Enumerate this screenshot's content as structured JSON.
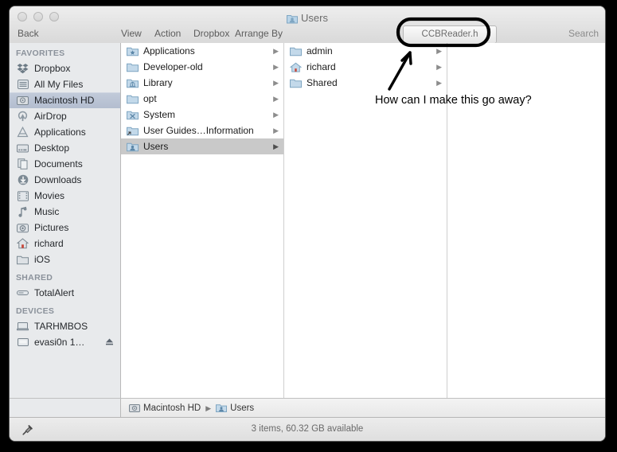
{
  "window": {
    "title": "Users",
    "title_icon": "users-folder-icon"
  },
  "toolbar": {
    "back_label": "Back",
    "view_label": "View",
    "action_label": "Action",
    "dropbox_label": "Dropbox",
    "arrange_by_label": "Arrange By",
    "proxy_item_label": "CCBReader.h",
    "search_label": "Search"
  },
  "sidebar": {
    "sections": [
      {
        "header": "FAVORITES",
        "items": [
          {
            "label": "Dropbox",
            "icon": "dropbox-icon",
            "selected": false
          },
          {
            "label": "All My Files",
            "icon": "all-my-files-icon",
            "selected": false
          },
          {
            "label": "Macintosh HD",
            "icon": "hard-disk-icon",
            "selected": true
          },
          {
            "label": "AirDrop",
            "icon": "airdrop-icon",
            "selected": false
          },
          {
            "label": "Applications",
            "icon": "applications-icon",
            "selected": false
          },
          {
            "label": "Desktop",
            "icon": "desktop-icon",
            "selected": false
          },
          {
            "label": "Documents",
            "icon": "documents-icon",
            "selected": false
          },
          {
            "label": "Downloads",
            "icon": "downloads-icon",
            "selected": false
          },
          {
            "label": "Movies",
            "icon": "movies-icon",
            "selected": false
          },
          {
            "label": "Music",
            "icon": "music-icon",
            "selected": false
          },
          {
            "label": "Pictures",
            "icon": "pictures-icon",
            "selected": false
          },
          {
            "label": "richard",
            "icon": "home-icon",
            "selected": false
          },
          {
            "label": "iOS",
            "icon": "folder-icon",
            "selected": false
          }
        ]
      },
      {
        "header": "SHARED",
        "items": [
          {
            "label": "TotalAlert",
            "icon": "shared-server-icon",
            "selected": false
          }
        ]
      },
      {
        "header": "DEVICES",
        "items": [
          {
            "label": "TARHMBOS",
            "icon": "laptop-icon",
            "selected": false,
            "eject": false
          },
          {
            "label": "evasi0n 1…",
            "icon": "disk-icon",
            "selected": false,
            "eject": true
          }
        ]
      }
    ]
  },
  "columns": [
    {
      "name": "column-1",
      "rows": [
        {
          "label": "Applications",
          "icon": "applications-folder-icon",
          "disclosure": true,
          "selected": false
        },
        {
          "label": "Developer-old",
          "icon": "folder-icon",
          "disclosure": true,
          "selected": false
        },
        {
          "label": "Library",
          "icon": "library-folder-icon",
          "disclosure": true,
          "selected": false
        },
        {
          "label": "opt",
          "icon": "folder-icon",
          "disclosure": true,
          "selected": false
        },
        {
          "label": "System",
          "icon": "system-folder-icon",
          "disclosure": true,
          "selected": false
        },
        {
          "label": "User Guides…Information",
          "icon": "alias-folder-icon",
          "disclosure": true,
          "selected": false
        },
        {
          "label": "Users",
          "icon": "users-folder-icon",
          "disclosure": true,
          "selected": true
        }
      ]
    },
    {
      "name": "column-2",
      "rows": [
        {
          "label": "admin",
          "icon": "folder-icon",
          "disclosure": true,
          "selected": false
        },
        {
          "label": "richard",
          "icon": "home-icon",
          "disclosure": true,
          "selected": false
        },
        {
          "label": "Shared",
          "icon": "folder-icon",
          "disclosure": true,
          "selected": false
        }
      ]
    },
    {
      "name": "column-3",
      "rows": []
    }
  ],
  "path_bar": {
    "crumbs": [
      {
        "label": "Macintosh HD",
        "icon": "hard-disk-icon"
      },
      {
        "label": "Users",
        "icon": "users-folder-icon"
      }
    ],
    "separator": "▶"
  },
  "status_bar": {
    "text": "3 items, 60.32 GB available",
    "icon": "skitch-pin-icon"
  },
  "annotations": {
    "note_text": "How can I make this go away?",
    "highlight_shape": "rounded-rectangle",
    "arrow": "up-right-arrow",
    "ink_color": "#000000"
  }
}
